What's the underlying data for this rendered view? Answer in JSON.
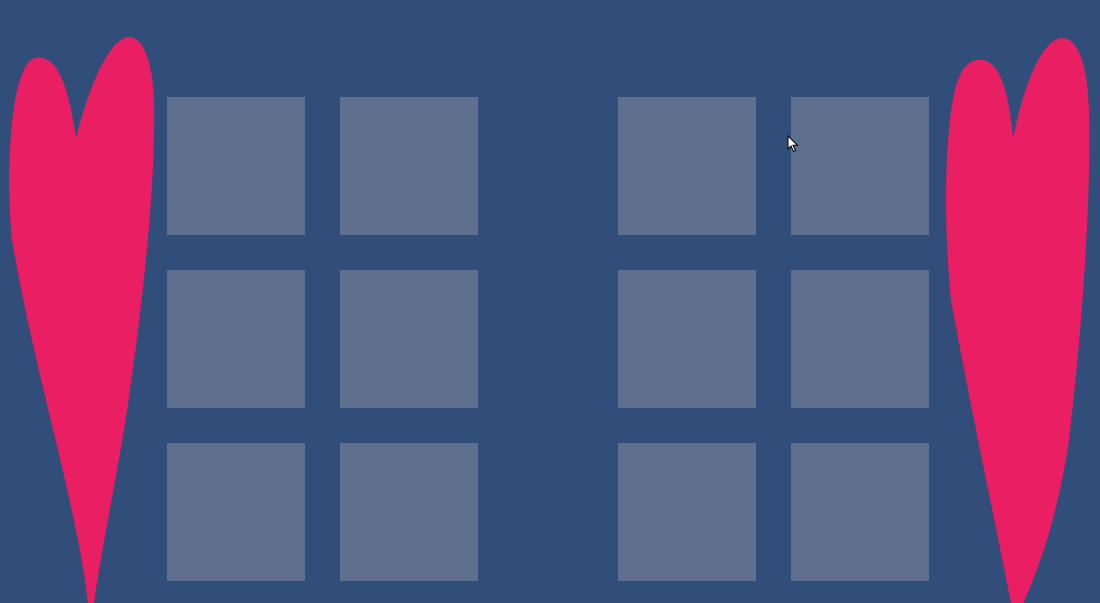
{
  "scene": {
    "background_color": "#314d79",
    "heart_color": "#e91e63",
    "slot_color": "#5e708d"
  },
  "decorations": {
    "left": {
      "icon": "heart-icon"
    },
    "right": {
      "icon": "heart-icon"
    }
  },
  "grids": [
    {
      "name": "left",
      "columns": 2,
      "rows": 3,
      "slots": [
        "",
        "",
        "",
        "",
        "",
        ""
      ]
    },
    {
      "name": "right",
      "columns": 2,
      "rows": 3,
      "slots": [
        "",
        "",
        "",
        "",
        "",
        ""
      ]
    }
  ],
  "cursor": {
    "icon": "mouse-pointer-icon"
  }
}
